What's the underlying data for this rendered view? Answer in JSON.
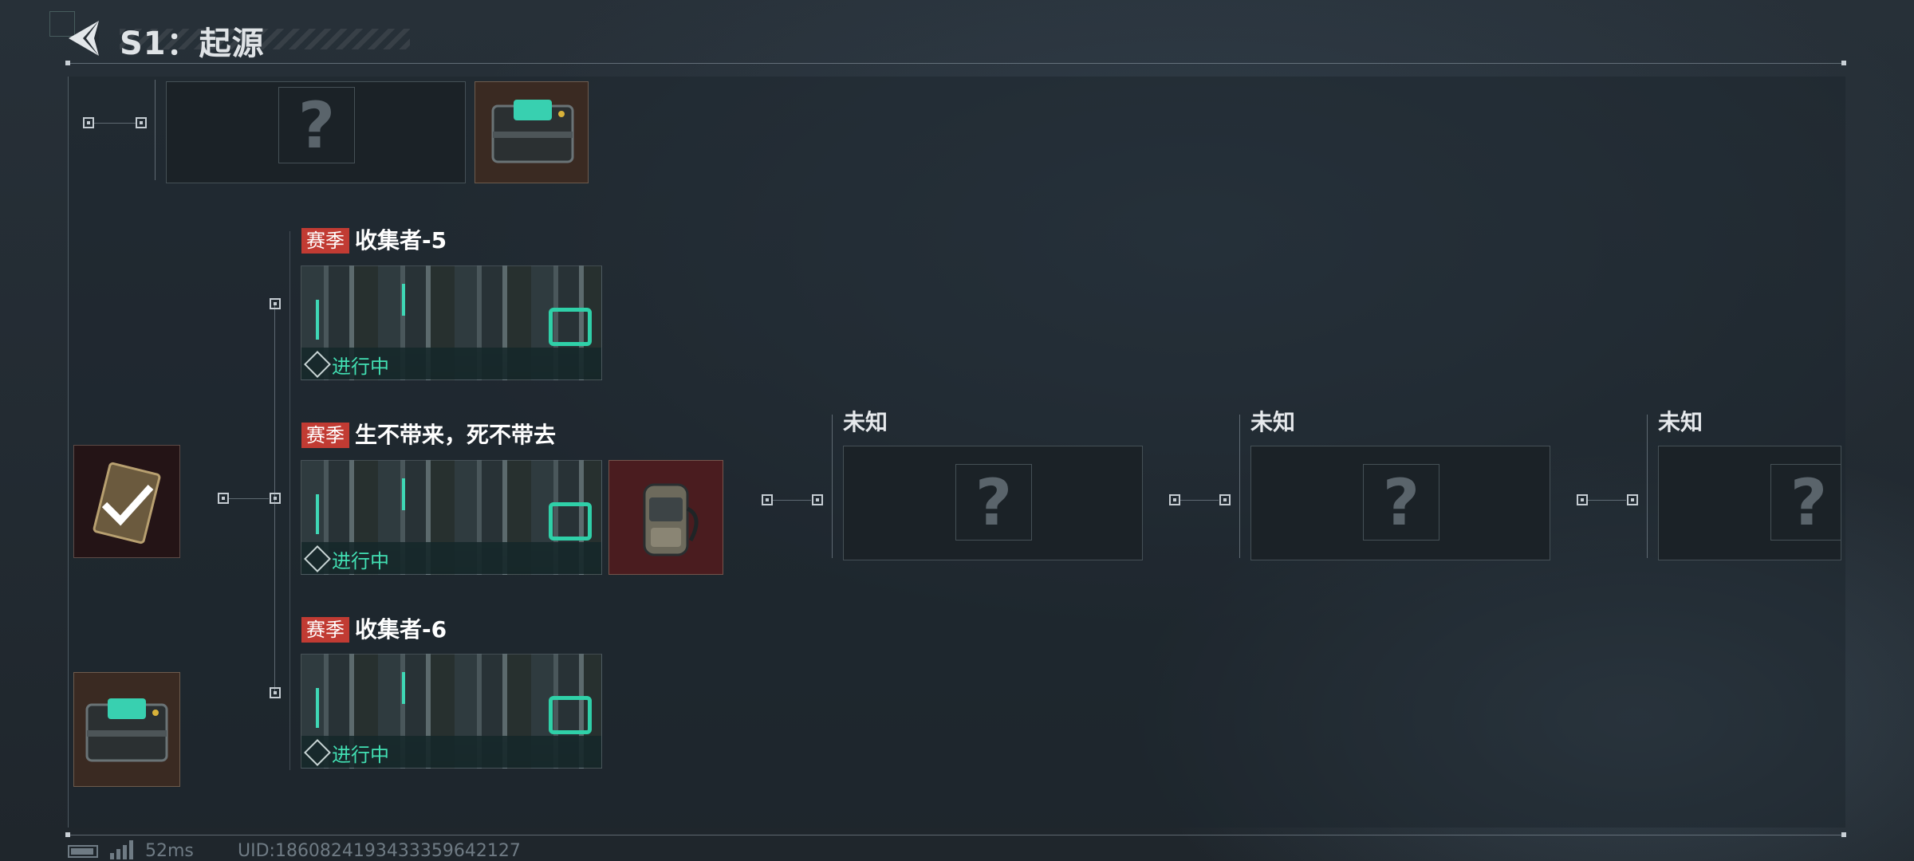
{
  "header": {
    "title": "S1：起源"
  },
  "quests": [
    {
      "tag": "赛季",
      "name": "收集者-5",
      "status": "进行中"
    },
    {
      "tag": "赛季",
      "name": "生不带来，死不带去",
      "status": "进行中"
    },
    {
      "tag": "赛季",
      "name": "收集者-6",
      "status": "进行中"
    }
  ],
  "unknowns": [
    {
      "label": "未知",
      "symbol": "?"
    },
    {
      "label": "未知",
      "symbol": "?"
    },
    {
      "label": "未知",
      "symbol": "?"
    }
  ],
  "top_card": {
    "symbol": "?"
  },
  "footer": {
    "ping": "52ms",
    "uid": "UID:1860824193433359642127"
  },
  "colors": {
    "tag": "#c13b33",
    "status": "#42e0b3",
    "background": "#242c33"
  },
  "icons": [
    "back-arrow-icon",
    "question-icon",
    "checkmark-icon",
    "supply-crate-icon",
    "backpack-icon",
    "battery-icon",
    "signal-icon",
    "status-diamond-icon"
  ]
}
